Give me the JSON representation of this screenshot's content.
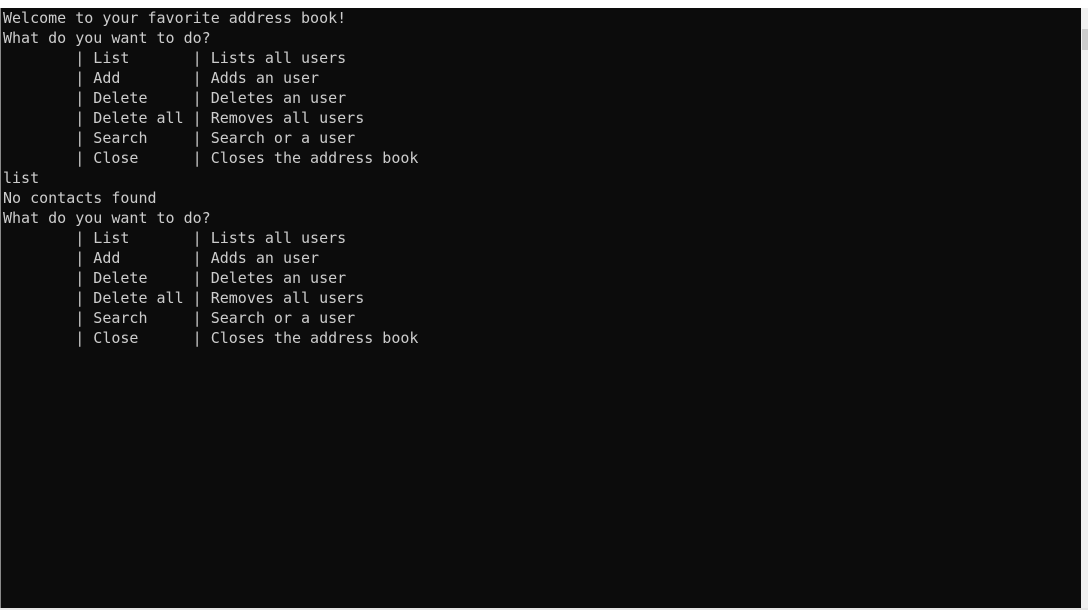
{
  "console": {
    "lines": [
      "Welcome to your favorite address book!",
      "What do you want to do?",
      "        | List       | Lists all users",
      "        | Add        | Adds an user",
      "        | Delete     | Deletes an user",
      "        | Delete all | Removes all users",
      "        | Search     | Search or a user",
      "        | Close      | Closes the address book",
      "list",
      "No contacts found",
      "What do you want to do?",
      "        | List       | Lists all users",
      "        | Add        | Adds an user",
      "        | Delete     | Deletes an user",
      "        | Delete all | Removes all users",
      "        | Search     | Search or a user",
      "        | Close      | Closes the address book"
    ],
    "background": "#0c0c0c",
    "foreground": "#cccccc"
  }
}
